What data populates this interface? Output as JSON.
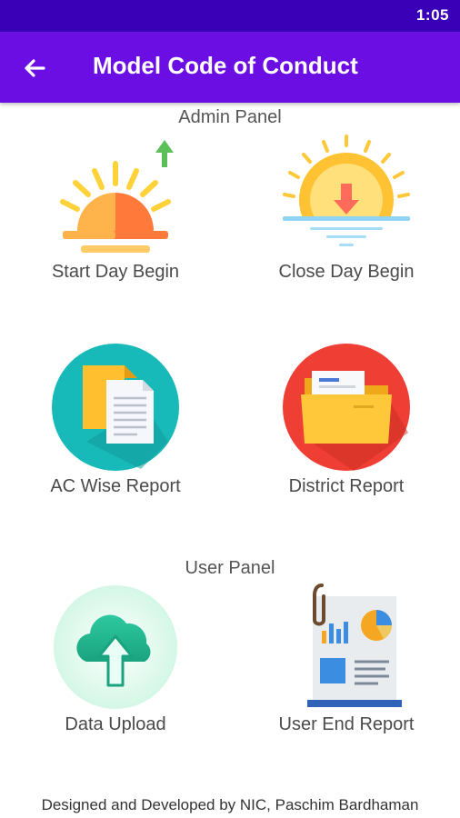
{
  "status_bar": {
    "time": "1:05"
  },
  "app_bar": {
    "title": "Model Code of Conduct",
    "back_icon": "arrow-left-icon"
  },
  "admin_panel": {
    "title": "Admin Panel",
    "items": [
      {
        "label": "Start Day Begin",
        "icon": "sunrise-icon"
      },
      {
        "label": "Close Day Begin",
        "icon": "sunset-icon"
      },
      {
        "label": "AC Wise Report",
        "icon": "documents-icon"
      },
      {
        "label": "District Report",
        "icon": "folder-icon"
      }
    ]
  },
  "user_panel": {
    "title": "User Panel",
    "items": [
      {
        "label": "Data Upload",
        "icon": "cloud-upload-icon"
      },
      {
        "label": "User End Report",
        "icon": "report-icon"
      }
    ]
  },
  "footer": {
    "text": "Designed and Developed by NIC, Paschim Bardhaman"
  },
  "colors": {
    "status_bar": "#3a00b8",
    "app_bar": "#6a0ee4"
  }
}
